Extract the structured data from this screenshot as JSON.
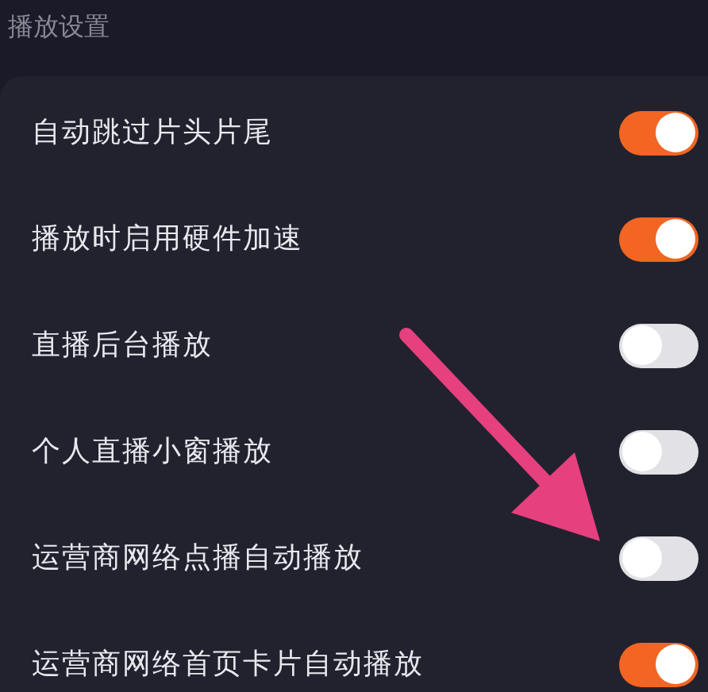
{
  "section_title": "播放设置",
  "settings": [
    {
      "label": "自动跳过片头片尾",
      "on": true
    },
    {
      "label": "播放时启用硬件加速",
      "on": true
    },
    {
      "label": "直播后台播放",
      "on": false
    },
    {
      "label": "个人直播小窗播放",
      "on": false
    },
    {
      "label": "运营商网络点播自动播放",
      "on": false
    },
    {
      "label": "运营商网络首页卡片自动播放",
      "on": true
    }
  ]
}
